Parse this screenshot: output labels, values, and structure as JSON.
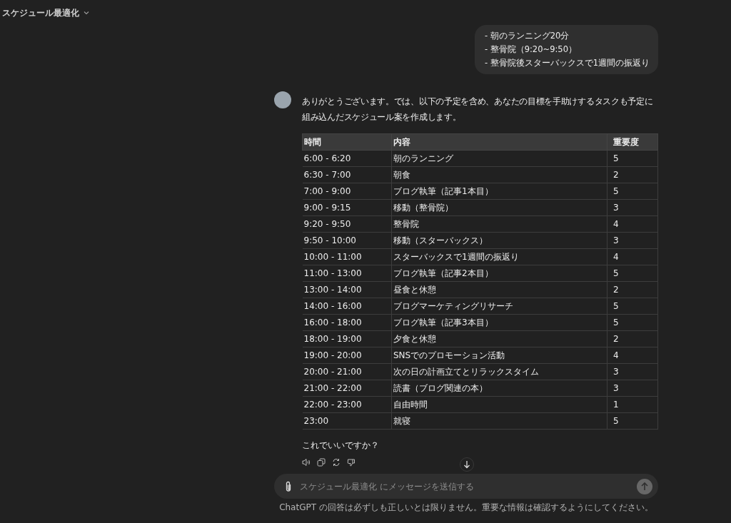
{
  "header": {
    "title": "スケジュール最適化"
  },
  "user_message": {
    "lines": [
      "- 朝のランニング20分",
      "- 整骨院（9:20~9:50）",
      "- 整骨院後スターバックスで1週間の振返り"
    ]
  },
  "assistant_message": {
    "intro": "ありがとうございます。では、以下の予定を含め、あなたの目標を手助けするタスクも予定に組み込んだスケジュール案を作成します。",
    "table": {
      "columns": [
        "時間",
        "内容",
        "重要度"
      ],
      "rows": [
        [
          "6:00 - 6:20",
          "朝のランニング",
          "5"
        ],
        [
          "6:30 - 7:00",
          "朝食",
          "2"
        ],
        [
          "7:00 - 9:00",
          "ブログ執筆（記事1本目）",
          "5"
        ],
        [
          "9:00 - 9:15",
          "移動（整骨院）",
          "3"
        ],
        [
          "9:20 - 9:50",
          "整骨院",
          "4"
        ],
        [
          "9:50 - 10:00",
          "移動（スターバックス）",
          "3"
        ],
        [
          "10:00 - 11:00",
          "スターバックスで1週間の振返り",
          "4"
        ],
        [
          "11:00 - 13:00",
          "ブログ執筆（記事2本目）",
          "5"
        ],
        [
          "13:00 - 14:00",
          "昼食と休憩",
          "2"
        ],
        [
          "14:00 - 16:00",
          "ブログマーケティングリサーチ",
          "5"
        ],
        [
          "16:00 - 18:00",
          "ブログ執筆（記事3本目）",
          "5"
        ],
        [
          "18:00 - 19:00",
          "夕食と休憩",
          "2"
        ],
        [
          "19:00 - 20:00",
          "SNSでのプロモーション活動",
          "4"
        ],
        [
          "20:00 - 21:00",
          "次の日の計画立てとリラックスタイム",
          "3"
        ],
        [
          "21:00 - 22:00",
          "読書（ブログ関連の本）",
          "3"
        ],
        [
          "22:00 - 23:00",
          "自由時間",
          "1"
        ],
        [
          "23:00",
          "就寝",
          "5"
        ]
      ]
    },
    "outro": "これでいいですか？"
  },
  "composer": {
    "placeholder": "スケジュール最適化 にメッセージを送信する"
  },
  "footer": "ChatGPT の回答は必ずしも正しいとは限りません。重要な情報は確認するようにしてください。"
}
